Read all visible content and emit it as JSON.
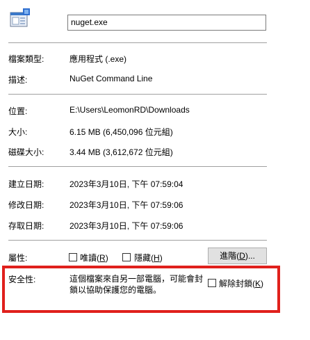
{
  "file_name": "nuget.exe",
  "fields": {
    "type_label": "檔案類型:",
    "type_value": "應用程式 (.exe)",
    "desc_label": "描述:",
    "desc_value": "NuGet Command Line",
    "location_label": "位置:",
    "location_value": "E:\\Users\\LeomonRD\\Downloads",
    "size_label": "大小:",
    "size_value": "6.15 MB (6,450,096 位元組)",
    "disk_label": "磁碟大小:",
    "disk_value": "3.44 MB (3,612,672 位元組)",
    "created_label": "建立日期:",
    "created_value": "2023年3月10日, 下午 07:59:04",
    "modified_label": "修改日期:",
    "modified_value": "2023年3月10日, 下午 07:59:06",
    "accessed_label": "存取日期:",
    "accessed_value": "2023年3月10日, 下午 07:59:06"
  },
  "attributes": {
    "label": "屬性:",
    "readonly_text": "唯讀",
    "readonly_key": "R",
    "hidden_text": "隱藏",
    "hidden_key": "H",
    "advanced_text": "進階",
    "advanced_key": "D",
    "advanced_suffix": "..."
  },
  "security": {
    "label": "安全性:",
    "message": "這個檔案來自另一部電腦，可能會封鎖以協助保護您的電腦。",
    "unblock_text": "解除封鎖",
    "unblock_key": "K"
  },
  "colors": {
    "highlight": "#e0201c"
  }
}
